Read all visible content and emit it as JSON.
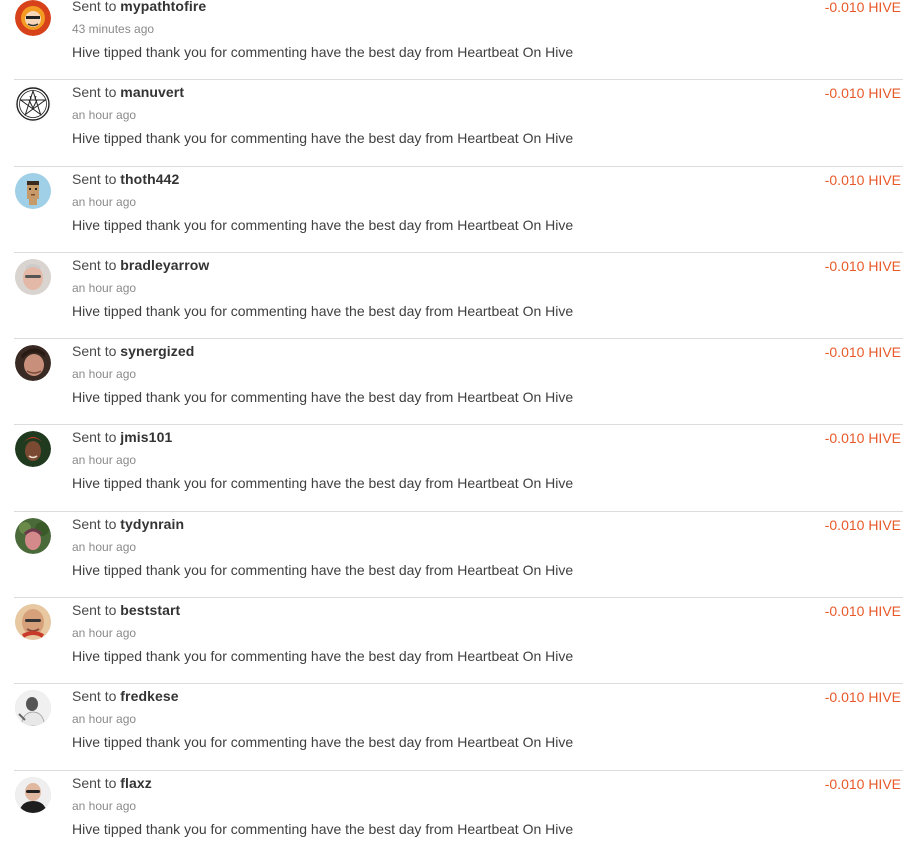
{
  "transactions": [
    {
      "sent_prefix": "Sent to",
      "recipient": "mypathtofire",
      "time": "43 minutes ago",
      "memo": "Hive tipped thank you for commenting have the best day from Heartbeat On Hive",
      "amount": "-0.010 HIVE",
      "avatar_icon": "red-orange-cartoon-avatar"
    },
    {
      "sent_prefix": "Sent to",
      "recipient": "manuvert",
      "time": "an hour ago",
      "memo": "Hive tipped thank you for commenting have the best day from Heartbeat On Hive",
      "amount": "-0.010 HIVE",
      "avatar_icon": "pentagram-goat-avatar"
    },
    {
      "sent_prefix": "Sent to",
      "recipient": "thoth442",
      "time": "an hour ago",
      "memo": "Hive tipped thank you for commenting have the best day from Heartbeat On Hive",
      "amount": "-0.010 HIVE",
      "avatar_icon": "pixel-character-avatar"
    },
    {
      "sent_prefix": "Sent to",
      "recipient": "bradleyarrow",
      "time": "an hour ago",
      "memo": "Hive tipped thank you for commenting have the best day from Heartbeat On Hive",
      "amount": "-0.010 HIVE",
      "avatar_icon": "photo-avatar"
    },
    {
      "sent_prefix": "Sent to",
      "recipient": "synergized",
      "time": "an hour ago",
      "memo": "Hive tipped thank you for commenting have the best day from Heartbeat On Hive",
      "amount": "-0.010 HIVE",
      "avatar_icon": "photo-avatar"
    },
    {
      "sent_prefix": "Sent to",
      "recipient": "jmis101",
      "time": "an hour ago",
      "memo": "Hive tipped thank you for commenting have the best day from Heartbeat On Hive",
      "amount": "-0.010 HIVE",
      "avatar_icon": "photo-avatar"
    },
    {
      "sent_prefix": "Sent to",
      "recipient": "tydynrain",
      "time": "an hour ago",
      "memo": "Hive tipped thank you for commenting have the best day from Heartbeat On Hive",
      "amount": "-0.010 HIVE",
      "avatar_icon": "photo-avatar"
    },
    {
      "sent_prefix": "Sent to",
      "recipient": "beststart",
      "time": "an hour ago",
      "memo": "Hive tipped thank you for commenting have the best day from Heartbeat On Hive",
      "amount": "-0.010 HIVE",
      "avatar_icon": "photo-avatar"
    },
    {
      "sent_prefix": "Sent to",
      "recipient": "fredkese",
      "time": "an hour ago",
      "memo": "Hive tipped thank you for commenting have the best day from Heartbeat On Hive",
      "amount": "-0.010 HIVE",
      "avatar_icon": "photo-avatar"
    },
    {
      "sent_prefix": "Sent to",
      "recipient": "flaxz",
      "time": "an hour ago",
      "memo": "Hive tipped thank you for commenting have the best day from Heartbeat On Hive",
      "amount": "-0.010 HIVE",
      "avatar_icon": "photo-avatar"
    }
  ],
  "colors": {
    "amount": "#e8592a",
    "divider": "#dcdcdc",
    "muted": "#8a8a8a"
  }
}
